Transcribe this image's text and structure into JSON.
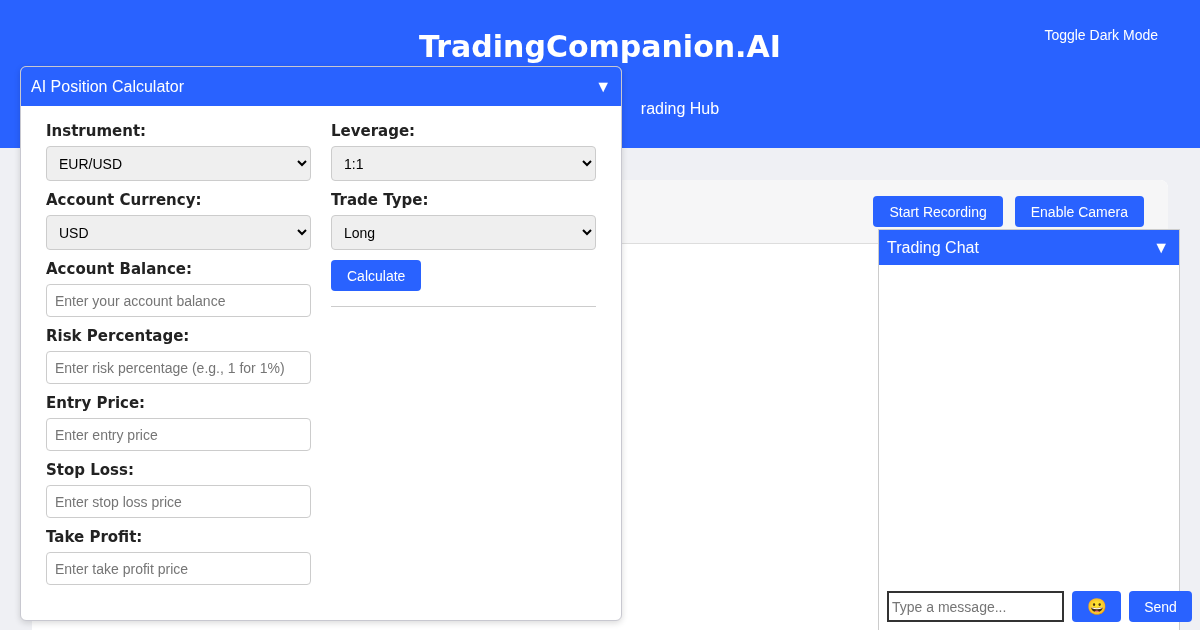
{
  "header": {
    "title": "TradingCompanion.AI",
    "subtitle": "rading Hub",
    "toggle": "Toggle Dark Mode"
  },
  "toolbar": {
    "buttons": [
      "Start Recording",
      "Enable Camera"
    ]
  },
  "calculator": {
    "title": "AI Position Calculator",
    "toggle": "▼",
    "left_fields": [
      {
        "kind": "select",
        "label": "Instrument:",
        "value": "EUR/USD"
      },
      {
        "kind": "select",
        "label": "Account Currency:",
        "value": "USD"
      },
      {
        "kind": "input",
        "label": "Account Balance:",
        "placeholder": "Enter your account balance"
      },
      {
        "kind": "input",
        "label": "Risk Percentage:",
        "placeholder": "Enter risk percentage (e.g., 1 for 1%)"
      },
      {
        "kind": "input",
        "label": "Entry Price:",
        "placeholder": "Enter entry price"
      },
      {
        "kind": "input",
        "label": "Stop Loss:",
        "placeholder": "Enter stop loss price"
      },
      {
        "kind": "input",
        "label": "Take Profit:",
        "placeholder": "Enter take profit price"
      }
    ],
    "right_fields": [
      {
        "kind": "select",
        "label": "Leverage:",
        "value": "1:1"
      },
      {
        "kind": "select",
        "label": "Trade Type:",
        "value": "Long"
      }
    ],
    "button": "Calculate"
  },
  "chat": {
    "title": "Trading Chat",
    "toggle": "▼",
    "placeholder": "Type a message...",
    "emoji_button": "😀",
    "send_button": "Send"
  }
}
